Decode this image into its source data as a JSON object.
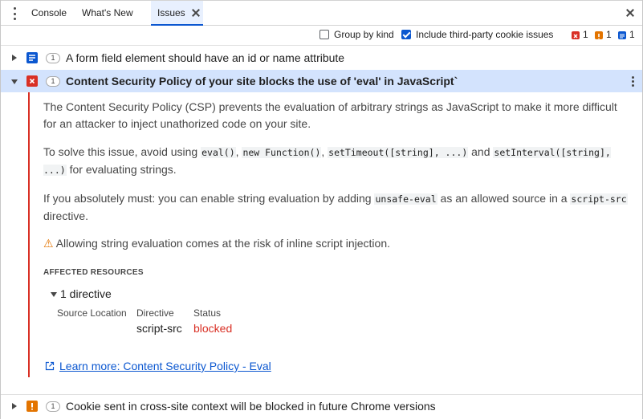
{
  "tabs": {
    "console": "Console",
    "whats_new": "What's New",
    "issues": "Issues"
  },
  "toolbar": {
    "group_by_kind": {
      "label": "Group by kind",
      "checked": false
    },
    "include_third_party": {
      "label": "Include third-party cookie issues",
      "checked": true
    },
    "counts": {
      "errors": "1",
      "warnings": "1",
      "info": "1"
    }
  },
  "issues": [
    {
      "title": "A form field element should have an id or name attribute",
      "count": "1",
      "kind": "info",
      "expanded": false
    },
    {
      "title": "Content Security Policy of your site blocks the use of 'eval' in JavaScript`",
      "count": "1",
      "kind": "error",
      "expanded": true
    },
    {
      "title": "Cookie sent in cross-site context will be blocked in future Chrome versions",
      "count": "1",
      "kind": "warning",
      "expanded": false
    }
  ],
  "details": {
    "para1": "The Content Security Policy (CSP) prevents the evaluation of arbitrary strings as JavaScript to make it more difficult for an attacker to inject unathorized code on your site.",
    "para2": {
      "prefix": "To solve this issue, avoid using ",
      "code1": "eval()",
      "sep1": ", ",
      "code2": "new Function()",
      "sep2": ", ",
      "code3": "setTimeout([string], ...)",
      "and": " and ",
      "code4": "setInterval([string], ...)",
      "suffix": " for evaluating strings."
    },
    "para3": {
      "prefix": "If you absolutely must: you can enable string evaluation by adding ",
      "code1": "unsafe-eval",
      "middle": " as an allowed source in a ",
      "code2": "script-src",
      "suffix": " directive."
    },
    "warning_text": "Allowing string evaluation comes at the risk of inline script injection.",
    "affected_heading": "AFFECTED RESOURCES",
    "directive_toggle": "1 directive",
    "table": {
      "headers": [
        "Source Location",
        "Directive",
        "Status"
      ],
      "row": {
        "source": "",
        "directive": "script-src",
        "status": "blocked"
      }
    },
    "learn_more": "Learn more: Content Security Policy - Eval"
  },
  "colors": {
    "accent": "#0b57d0",
    "error": "#d93025",
    "warning": "#e37400",
    "selected_row": "#d3e3fd"
  }
}
